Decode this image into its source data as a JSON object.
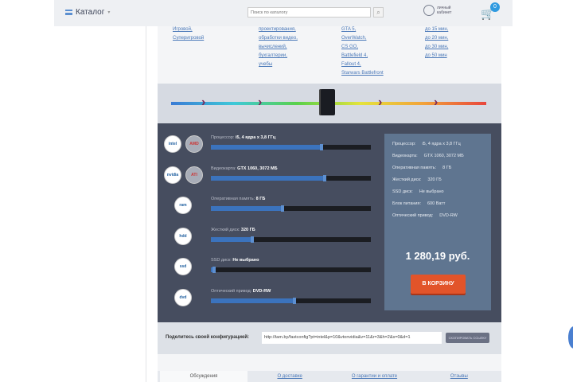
{
  "header": {
    "catalog": "Каталог",
    "search_placeholder": "Поиск по каталогу",
    "account": "личный кабинет",
    "cart_count": "0"
  },
  "links": {
    "col1": [
      "Игровой,",
      "Суперигровой"
    ],
    "col2": [
      "проектирования,",
      "обработки видео,",
      "вычислений,",
      "бухгалтерии,",
      "учебы"
    ],
    "col3": [
      "GTA 5,",
      "OverWatch,",
      "CS GO,",
      "Battlefield 4,",
      "Fallout 4,",
      "Starwars Battlefront"
    ],
    "col4": [
      "до 15 мин,",
      "до 20 мин,",
      "до 30 мин,",
      "до 50 мин"
    ]
  },
  "config": [
    {
      "label": "Процессор:",
      "value": "i5, 4 ядра x 3,8 ГГц",
      "fill": 0.69,
      "icons": [
        "intel",
        "AMD"
      ]
    },
    {
      "label": "Видеокарта:",
      "value": "GTX 1060, 3072 МБ",
      "fill": 0.71,
      "icons": [
        "nvidia",
        "ATI"
      ]
    },
    {
      "label": "Оперативная память:",
      "value": "8 ГБ",
      "fill": 0.45,
      "icons": [
        "ram"
      ]
    },
    {
      "label": "Жесткий диск:",
      "value": "320 ГБ",
      "fill": 0.26,
      "icons": [
        "hdd"
      ]
    },
    {
      "label": "SSD диск:",
      "value": "Не выбрано",
      "fill": 0.02,
      "icons": [
        "ssd"
      ]
    },
    {
      "label": "Оптический привод:",
      "value": "DVD-RW",
      "fill": 0.52,
      "icons": [
        "dvd"
      ]
    }
  ],
  "summary": [
    [
      "Процессор:",
      "i5, 4 ядра x 3,8 ГГц"
    ],
    [
      "Видеокарта:",
      "GTX 1060, 3072 МБ"
    ],
    [
      "Оперативная память:",
      "8 ГБ"
    ],
    [
      "Жесткий диск:",
      "320 ГБ"
    ],
    [
      "SSD диск:",
      "Не выбрано"
    ],
    [
      "Блок питания:",
      "600 Ватт"
    ],
    [
      "Оптический привод:",
      "DVD-RW"
    ]
  ],
  "price": "1 280,19 руб.",
  "buy": "В КОРЗИНУ",
  "share": {
    "label": "Поделитесь своей конфигурацией:",
    "url": "http://tam.by/fastconfig?pt=intel&p=10&vtonvidia&v=11&r=3&h=2&s=0&d=1",
    "button": "СКОПИРОВАТЬ ССЫЛКУ"
  },
  "tabs": [
    "Обсуждения",
    "О доставке",
    "О гарантии и оплате",
    "Отзывы"
  ]
}
